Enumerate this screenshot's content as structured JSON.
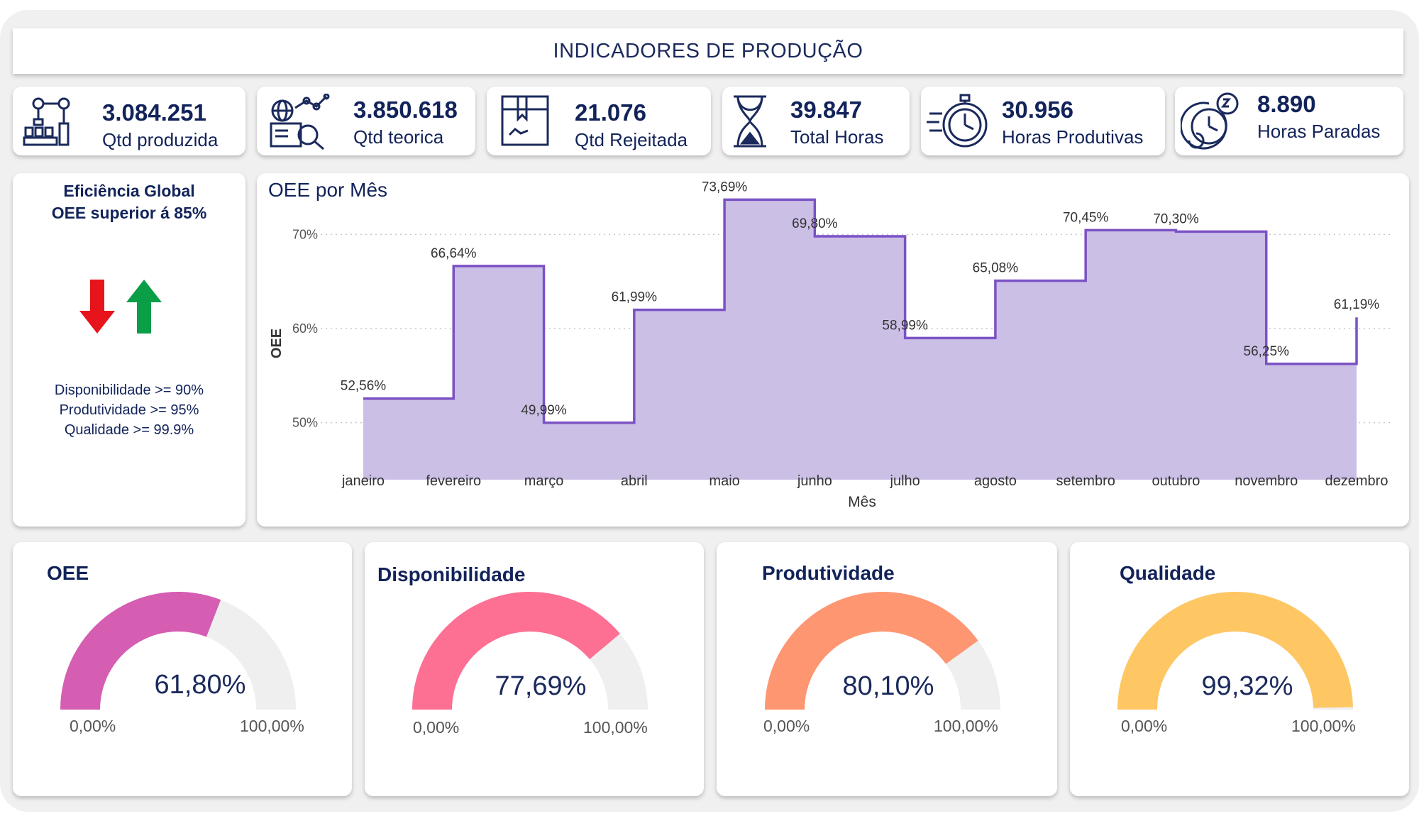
{
  "header": {
    "title": "INDICADORES DE PRODUÇÃO"
  },
  "kpis": [
    {
      "value": "3.084.251",
      "label": "Qtd produzida",
      "icon": "robot-arm-production-icon"
    },
    {
      "value": "3.850.618",
      "label": "Qtd teorica",
      "icon": "globe-analytics-icon"
    },
    {
      "value": "21.076",
      "label": "Qtd Rejeitada",
      "icon": "rejected-box-icon"
    },
    {
      "value": "39.847",
      "label": "Total Horas",
      "icon": "hourglass-icon"
    },
    {
      "value": "30.956",
      "label": "Horas Produtivas",
      "icon": "stopwatch-icon"
    },
    {
      "value": "8.890",
      "label": "Horas Paradas",
      "icon": "clock-sleep-icon"
    }
  ],
  "info": {
    "title_line1": "Eficiência Global",
    "title_line2": "OEE superior á 85%",
    "lines": [
      "Disponibilidade >= 90%",
      "Produtividade >= 95%",
      "Qualidade >= 99.9%"
    ],
    "arrow_down_color": "#e8141b",
    "arrow_up_color": "#0a9e47"
  },
  "chart_data": {
    "type": "area",
    "title": "OEE por Mês",
    "xlabel": "Mês",
    "ylabel": "OEE",
    "categories": [
      "janeiro",
      "fevereiro",
      "março",
      "abril",
      "maio",
      "junho",
      "julho",
      "agosto",
      "setembro",
      "outubro",
      "novembro",
      "dezembro"
    ],
    "values": [
      52.56,
      66.64,
      49.99,
      61.99,
      73.69,
      69.8,
      58.99,
      65.08,
      70.45,
      70.3,
      56.25,
      61.19
    ],
    "labels": [
      "52,56%",
      "66,64%",
      "49,99%",
      "61,99%",
      "73,69%",
      "69,80%",
      "58,99%",
      "65,08%",
      "70,45%",
      "70,30%",
      "56,25%",
      "61,19%"
    ],
    "yticks": [
      50,
      60,
      70
    ],
    "ytick_labels": [
      "50%",
      "60%",
      "70%"
    ],
    "ylim": [
      45,
      75
    ],
    "step": true,
    "grid": true,
    "line_color": "#7b52c4",
    "fill_color": "#cbbfe6"
  },
  "gauges": [
    {
      "title": "OEE",
      "value": 61.8,
      "value_label": "61,80%",
      "min_label": "0,00%",
      "max_label": "100,00%",
      "color": "#d55db2"
    },
    {
      "title": "Disponibilidade",
      "value": 77.69,
      "value_label": "77,69%",
      "min_label": "0,00%",
      "max_label": "100,00%",
      "color": "#fd6f93"
    },
    {
      "title": "Produtividade",
      "value": 80.1,
      "value_label": "80,10%",
      "min_label": "0,00%",
      "max_label": "100,00%",
      "color": "#fe9672"
    },
    {
      "title": "Qualidade",
      "value": 99.32,
      "value_label": "99,32%",
      "min_label": "0,00%",
      "max_label": "100,00%",
      "color": "#fec763"
    }
  ]
}
